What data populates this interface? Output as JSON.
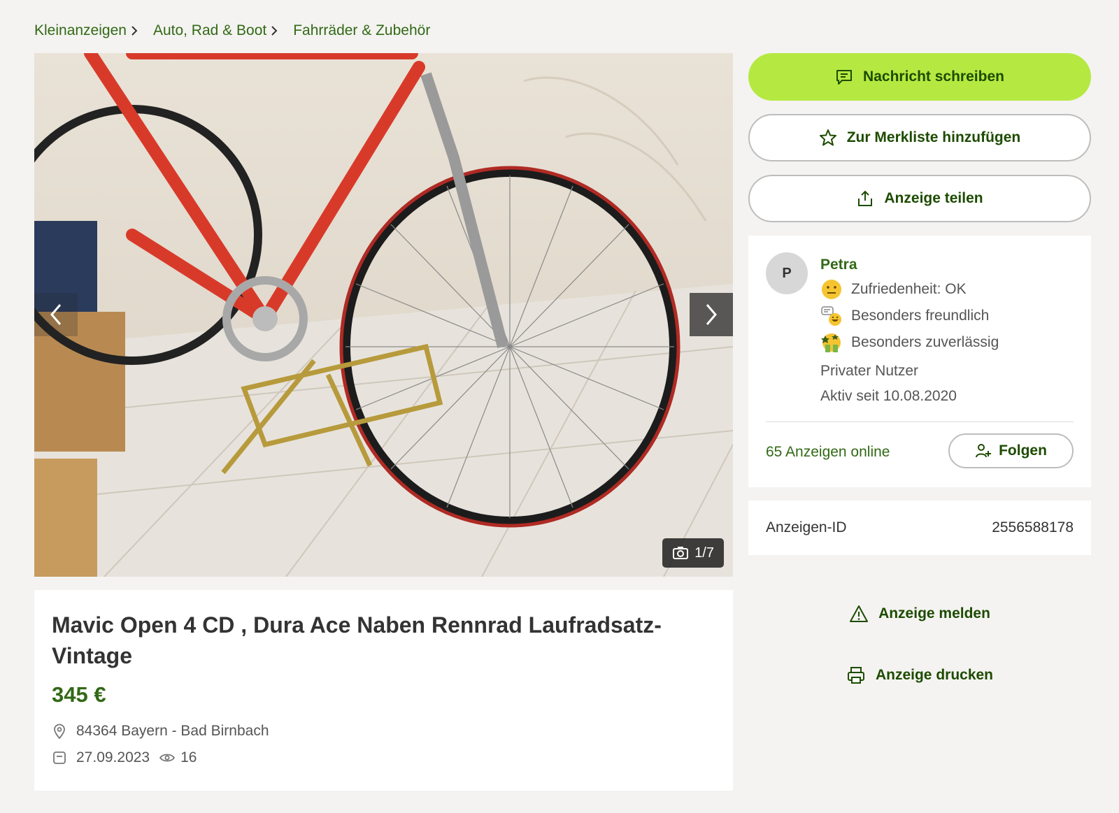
{
  "breadcrumb": [
    "Kleinanzeigen",
    "Auto, Rad & Boot",
    "Fahrräder & Zubehör"
  ],
  "gallery": {
    "counter": "1/7"
  },
  "listing": {
    "title": "Mavic Open 4 CD , Dura Ace Naben Rennrad Laufradsatz- Vintage",
    "price": "345 €",
    "location": "84364 Bayern - Bad Birnbach",
    "date": "27.09.2023",
    "views": "16"
  },
  "actions": {
    "message": "Nachricht schreiben",
    "watchlist": "Zur Merkliste hinzufügen",
    "share": "Anzeige teilen",
    "report": "Anzeige melden",
    "print": "Anzeige drucken"
  },
  "seller": {
    "initial": "P",
    "name": "Petra",
    "badges": [
      {
        "label": "Zufriedenheit: OK",
        "icon": "neutral-face-icon"
      },
      {
        "label": "Besonders freundlich",
        "icon": "friendly-chat-icon"
      },
      {
        "label": "Besonders zuverlässig",
        "icon": "reliable-thumbs-icon"
      }
    ],
    "type": "Privater Nutzer",
    "active_since": "Aktiv seit 10.08.2020",
    "ads_online": "65 Anzeigen online",
    "follow_label": "Folgen"
  },
  "ad_id": {
    "label": "Anzeigen-ID",
    "value": "2556588178"
  },
  "colors": {
    "accent_green": "#b5e941",
    "link_green": "#326916",
    "background": "#f4f3f1"
  }
}
